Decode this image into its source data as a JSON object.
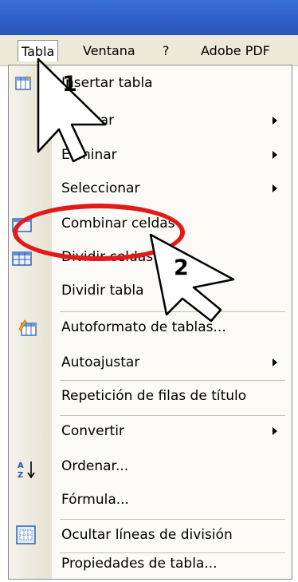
{
  "menubar": {
    "items": [
      {
        "label": "Tabla"
      },
      {
        "label": "Ventana"
      },
      {
        "label": "?"
      },
      {
        "label": "Adobe PDF"
      }
    ]
  },
  "menu": {
    "items": [
      {
        "label": "Insertar tabla"
      },
      {
        "label": "Insertar"
      },
      {
        "label": "Eliminar"
      },
      {
        "label": "Seleccionar"
      },
      {
        "label": "Combinar celdas"
      },
      {
        "label": "Dividir celdas"
      },
      {
        "label": "Dividir tabla"
      },
      {
        "label": "Autoformato de tablas..."
      },
      {
        "label": "Autoajustar"
      },
      {
        "label": "Repetición de filas de título"
      },
      {
        "label": "Convertir"
      },
      {
        "label": "Ordenar..."
      },
      {
        "label": "Fórmula..."
      },
      {
        "label": "Ocultar líneas de división"
      },
      {
        "label": "Propiedades de tabla..."
      }
    ]
  },
  "annotations": {
    "step1": "1",
    "step2": "2"
  },
  "colors": {
    "titlebar": "#2f5fc9",
    "highlight_ellipse": "#e21a1a"
  }
}
